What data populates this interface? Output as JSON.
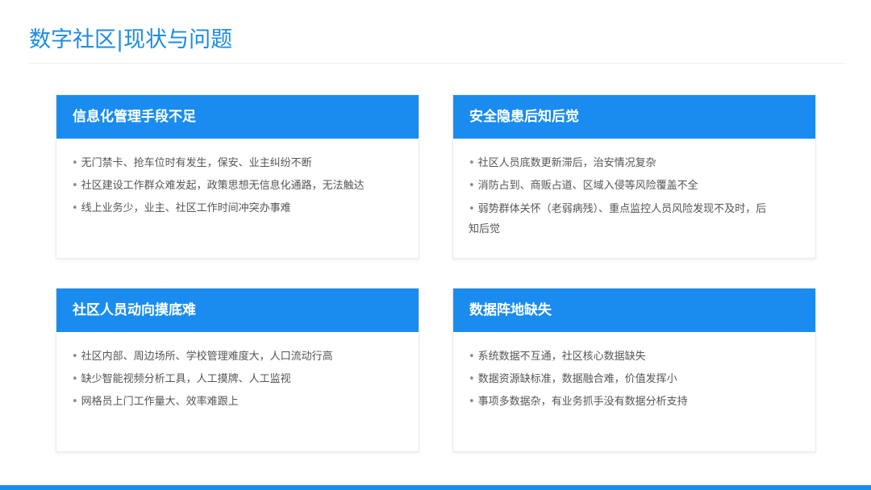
{
  "page": {
    "title": "数字社区|现状与问题"
  },
  "cards": [
    {
      "title": "信息化管理手段不足",
      "items": [
        "无门禁卡、抢车位时有发生，保安、业主纠纷不断",
        "社区建设工作群众难发起，政策思想无信息化通路，无法触达",
        "线上业务少，业主、社区工作时间冲突办事难"
      ]
    },
    {
      "title": "安全隐患后知后觉",
      "items": [
        "社区人员底数更新滞后，治安情况复杂",
        "消防占到、商贩占道、区域入侵等风险覆盖不全",
        "弱势群体关怀（老弱病残）、重点监控人员风险发现不及时，后知后觉"
      ]
    },
    {
      "title": "社区人员动向摸底难",
      "items": [
        "社区内部、周边场所、学校管理难度大，人口流动行高",
        "缺少智能视频分析工具，人工摸牌、人工监视",
        "网格员上门工作量大、效率难跟上"
      ]
    },
    {
      "title": "数据阵地缺失",
      "items": [
        "系统数据不互通，社区核心数据缺失",
        "数据资源缺标准，数据融合难，价值发挥小",
        "事项多数据杂，有业务抓手没有数据分析支持"
      ]
    }
  ],
  "bullet_symbol": "•",
  "colors": {
    "accent": "#1a8cf0",
    "title": "#1a8be8",
    "body_text": "#555555"
  }
}
